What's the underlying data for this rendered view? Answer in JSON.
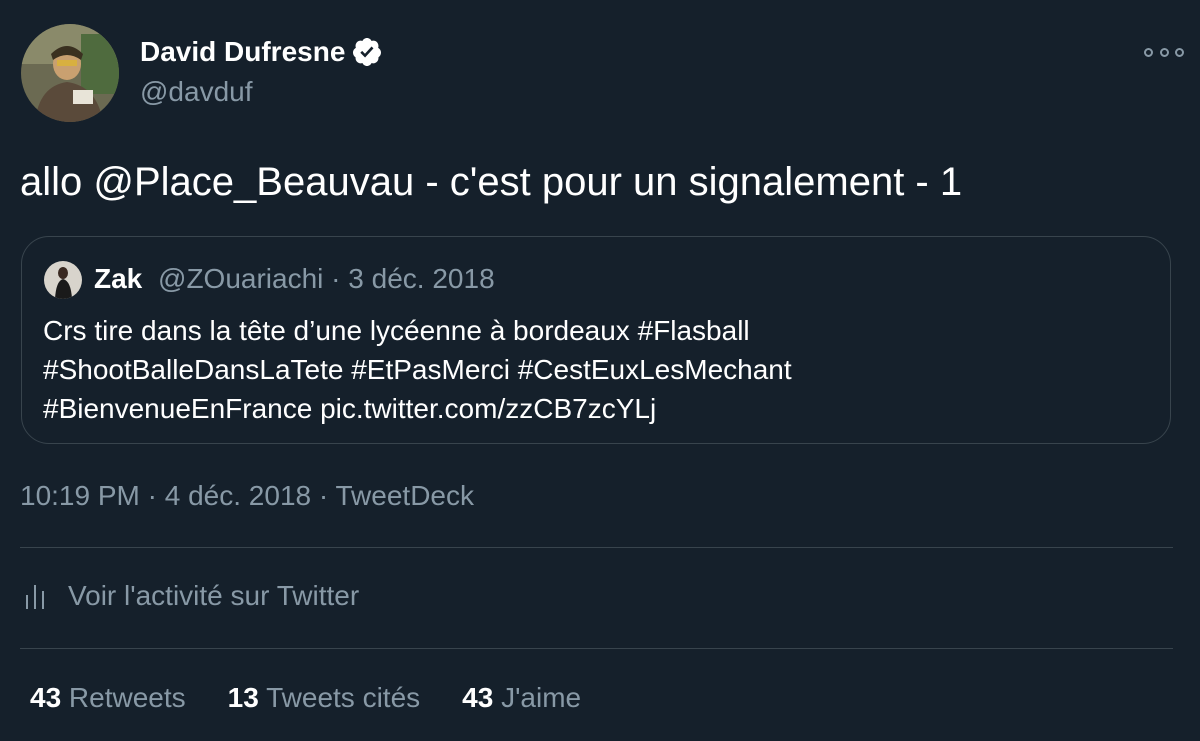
{
  "author": {
    "name": "David Dufresne",
    "handle": "@davduf"
  },
  "tweet": {
    "text": "allo @Place_Beauvau - c'est pour un signalement - 1"
  },
  "quoted": {
    "name": "Zak",
    "handle": "@ZOuariachi",
    "separator": " · ",
    "date": "3 déc. 2018",
    "lines": [
      "Crs tire dans la tête d’une lycéenne  à bordeaux #Flasball",
      "#ShootBalleDansLaTete #EtPasMerci #CestEuxLesMechant",
      "#BienvenueEnFrance pic.twitter.com/zzCB7zcYLj"
    ]
  },
  "meta": {
    "time": "10:19 PM",
    "separator": " · ",
    "date": "4 déc. 2018",
    "source": "TweetDeck"
  },
  "activity": {
    "label": "Voir l'activité sur Twitter"
  },
  "stats": {
    "retweets": {
      "count": "43",
      "label": " Retweets"
    },
    "quotes": {
      "count": "13",
      "label": " Tweets cités"
    },
    "likes": {
      "count": "43",
      "label": " J'aime"
    }
  },
  "colors": {
    "background": "#15202b",
    "text": "#ffffff",
    "secondary": "#8899a6",
    "border": "#38444d"
  },
  "icons": {
    "verified": "verified-badge-icon",
    "more": "more-options-icon",
    "activity": "bar-chart-icon"
  }
}
